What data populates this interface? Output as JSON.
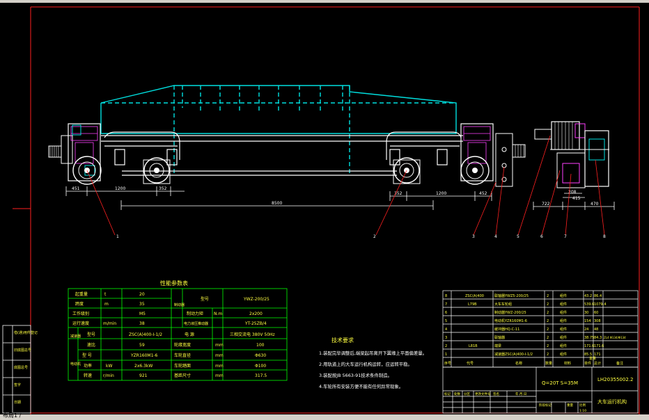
{
  "colors": {
    "background": "#000000",
    "frame_red": "#ff2020",
    "machine_white": "#ffffff",
    "trolley_cyan": "#00e0e0",
    "table_green": "#00ff00",
    "text_yellow": "#ffff40",
    "detail_magenta": "#ff40ff"
  },
  "dimensions": {
    "d451_left": "451",
    "d1200_left": "1200",
    "d352_left": "352",
    "d8500": "8500",
    "d352_right": "352",
    "d1200_right": "1200",
    "d452_right": "452",
    "d722": "722",
    "d415": "415",
    "d208": "208",
    "d470": "470"
  },
  "callouts": [
    "1",
    "2",
    "3",
    "4",
    "5",
    "6",
    "7",
    "8"
  ],
  "perf_table": {
    "title": "性能参数表",
    "rows": [
      {
        "label": "起重量",
        "unit": "t",
        "value": "20"
      },
      {
        "label": "跨度",
        "unit": "m",
        "value": "35"
      },
      {
        "label": "工作级别",
        "unit": "",
        "value": "M5"
      },
      {
        "label": "运行速度",
        "unit": "m/min",
        "value": "38"
      }
    ],
    "brake": {
      "group": "制动器",
      "model_label": "型号",
      "model_value": "YWZ-200/25",
      "torque_label": "制动力矩",
      "torque_unit": "N.m",
      "torque_value": "2x200",
      "pusher_label": "电力液压推动器",
      "pusher_value": "YT-25ZB/4"
    },
    "reducer": {
      "group": "减速器",
      "model_label": "型号",
      "model_value": "ZSC(A)400-I-1/2",
      "ratio_label": "速比",
      "ratio_value": "59"
    },
    "power": {
      "label": "电    源",
      "value": "三相交流电   380V 50Hz"
    },
    "motor": {
      "group": "电动机",
      "model_label": "型    号",
      "model_value": "YZR160M1-6",
      "power_label": "功率",
      "power_unit": "kW",
      "power_value": "2x6.3kW",
      "speed_label": "转速",
      "speed_unit": "r/min",
      "speed_value": "921"
    },
    "wheel": [
      {
        "label": "轮缘宽度",
        "unit": "mm",
        "value": "100"
      },
      {
        "label": "车轮直径",
        "unit": "mm",
        "value": "Φ630"
      },
      {
        "label": "车轮踏面",
        "unit": "mm",
        "value": "Φ100"
      },
      {
        "label": "基距尺寸",
        "unit": "mm",
        "value": "317.5"
      }
    ]
  },
  "tech_req": {
    "title": "技术要求",
    "items": [
      "1.装配完毕调整后,端梁起吊离开下翼缘上平面偏差量。",
      "2.用轨道上的大车运行机构运转，应运转平稳。",
      "3.装配按JB 5663-91技术条件制造。",
      "4.车轮所有安装方便不能有任何异常现象。"
    ]
  },
  "bom": {
    "rows": [
      {
        "no": "8",
        "code": "ZSC(A)400",
        "name": "联轴器YWZ5-200/25",
        "qty": "2",
        "mat": "组件",
        "w1": "43.2",
        "w2": "86.4",
        "note": ""
      },
      {
        "no": "7",
        "code": "L79B",
        "name": "大车车轮组",
        "qty": "2",
        "mat": "组件",
        "w1": "539.6",
        "w2": "1079.4",
        "note": ""
      },
      {
        "no": "6",
        "code": "",
        "name": "制动器YWZ-200/25",
        "qty": "2",
        "mat": "组件",
        "w1": "30",
        "w2": "60",
        "note": ""
      },
      {
        "no": "5",
        "code": "",
        "name": "电动机YZR160M1-6",
        "qty": "2",
        "mat": "组件",
        "w1": "154",
        "w2": "308",
        "note": ""
      },
      {
        "no": "4",
        "code": "",
        "name": "缓冲器HQ-C-11",
        "qty": "2",
        "mat": "组件",
        "w1": "24",
        "w2": "48",
        "note": ""
      },
      {
        "no": "3",
        "code": "",
        "name": "联轴器",
        "qty": "2",
        "mat": "组件",
        "w1": "38.75",
        "w2": "84.3",
        "note": "ZL4 Φ134/Φ134"
      },
      {
        "no": "2",
        "code": "L81B",
        "name": "端梁",
        "qty": "2",
        "mat": "组件",
        "w1": "171.6",
        "w2": "171.6",
        "note": ""
      },
      {
        "no": "1",
        "code": "",
        "name": "减速器ZSC(A)400-I-1/2",
        "qty": "2",
        "mat": "组件",
        "w1": "85.5",
        "w2": "171",
        "note": ""
      }
    ],
    "header": [
      "序号",
      "代号",
      "名称",
      "数量",
      "材料",
      "单件",
      "总计",
      "备注"
    ],
    "header_weight": "重量"
  },
  "title_block": {
    "spec": "Q=20T   S=35M",
    "drawing_no": "LH20355002.2",
    "name": "大车运行机构",
    "small_labels": [
      "标记",
      "处数",
      "分区",
      "更改文件号",
      "签名",
      "年.月.日"
    ],
    "stage_label": "阶段标记",
    "weight_label": "重量",
    "scale_label": "比例",
    "scale_value": "1:10"
  },
  "left_strip": {
    "labels": [
      "借(通)用件登记",
      "旧底图总号",
      "底图总号",
      "签字",
      "日期"
    ]
  },
  "status": {
    "layout_tab": "布局1 /"
  }
}
